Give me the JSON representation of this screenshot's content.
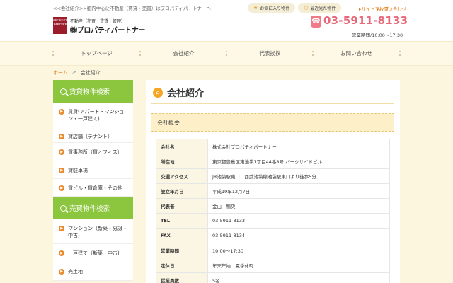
{
  "header": {
    "tagline": "<<会社紹介>>都内中心に不動産（賃貸・売買）はプロパティパートナーへ",
    "logo_box": "PROPERTY PARTNER",
    "logo_sub": "不動産（売買・賃貸・管理）",
    "logo_main": "㈱プロパティパートナー",
    "favorites": "お気に入り物件",
    "recent": "最近見た物件",
    "sitemap": "サイトマップ",
    "contact": "お問い合わせ",
    "phone": "03-5911-8133",
    "hours": "営業時間/10:00～17:30"
  },
  "nav": [
    "トップページ",
    "会社紹介",
    "代表挨拶",
    "お問い合わせ"
  ],
  "breadcrumb": {
    "home": "ホーム",
    "arrow": ">",
    "current": "会社紹介"
  },
  "sidebar": {
    "rent_title": "賃貸物件検索",
    "rent_items": [
      "賃貸(アパート・マンション・一戸建て)",
      "貸店舗（テナント）",
      "貸事務所（貸オフィス）",
      "貸駐車場",
      "貸ビル・貸倉庫・その他"
    ],
    "sale_title": "売買物件検索",
    "sale_items": [
      "マンション（新築・分譲・中古)",
      "一戸建て（新築・中古)",
      "売土地"
    ]
  },
  "main": {
    "title": "会社紹介",
    "section": "会社概要",
    "rows": [
      {
        "label": "会社名",
        "value": "株式会社プロパティパートナー"
      },
      {
        "label": "所在地",
        "value": "東京都豊島区東池袋1丁目44番8号 パークサイドビル"
      },
      {
        "label": "交通アクセス",
        "value": "JR池袋駅東口、西武池袋線池袋駅東口より徒歩5分"
      },
      {
        "label": "設立年月日",
        "value": "平成19年12月7日"
      },
      {
        "label": "代表者",
        "value": "金山　暢央"
      },
      {
        "label": "TEL",
        "value": "03-5911-8133"
      },
      {
        "label": "FAX",
        "value": "03-5911-8134"
      },
      {
        "label": "営業時間",
        "value": "10:00～17:30"
      },
      {
        "label": "定休日",
        "value": "年末年始　夏季休暇"
      },
      {
        "label": "従業員数",
        "value": "5名"
      }
    ]
  },
  "colors": {
    "accent": "#8cc63f",
    "phone": "#e8697a",
    "link": "#e07a10",
    "section_bg": "#fdf0c9"
  }
}
